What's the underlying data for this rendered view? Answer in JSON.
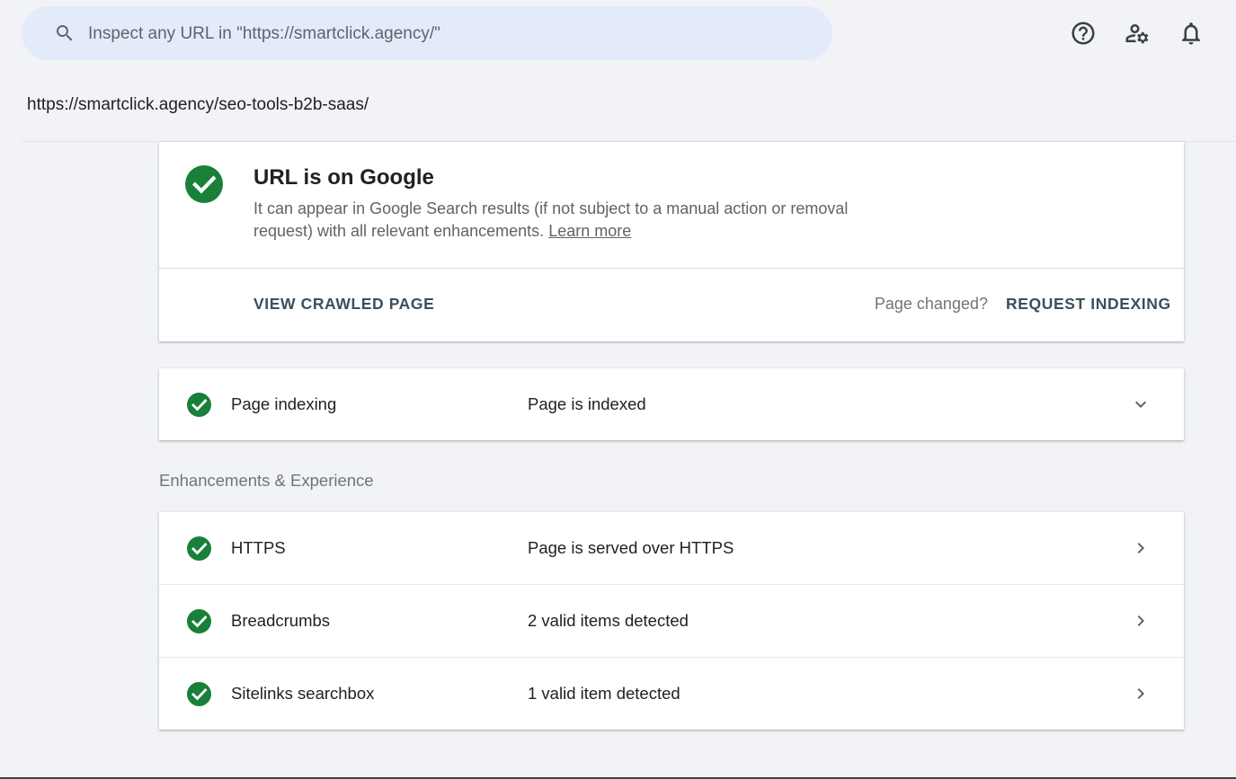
{
  "search": {
    "placeholder": "Inspect any URL in \"https://smartclick.agency/\""
  },
  "header_icons": [
    "help-icon",
    "manage-users-icon",
    "notifications-icon"
  ],
  "inspected_url": "https://smartclick.agency/seo-tools-b2b-saas/",
  "status": {
    "title": "URL is on Google",
    "description": "It can appear in Google Search results (if not subject to a manual action or removal request) with all relevant enhancements.",
    "learn_more": "Learn more",
    "view_crawled_page": "VIEW CRAWLED PAGE",
    "page_changed": "Page changed?",
    "request_indexing": "REQUEST INDEXING"
  },
  "indexing": {
    "name": "Page indexing",
    "value": "Page is indexed"
  },
  "enhancements": {
    "section_label": "Enhancements & Experience",
    "items": [
      {
        "name": "HTTPS",
        "value": "Page is served over HTTPS"
      },
      {
        "name": "Breadcrumbs",
        "value": "2 valid items detected"
      },
      {
        "name": "Sitelinks searchbox",
        "value": "1 valid item detected"
      }
    ]
  },
  "colors": {
    "success_green": "#188038",
    "search_bg": "#e3ebfb",
    "page_bg": "#f1f3f6",
    "action_text": "#3c4f5b"
  }
}
